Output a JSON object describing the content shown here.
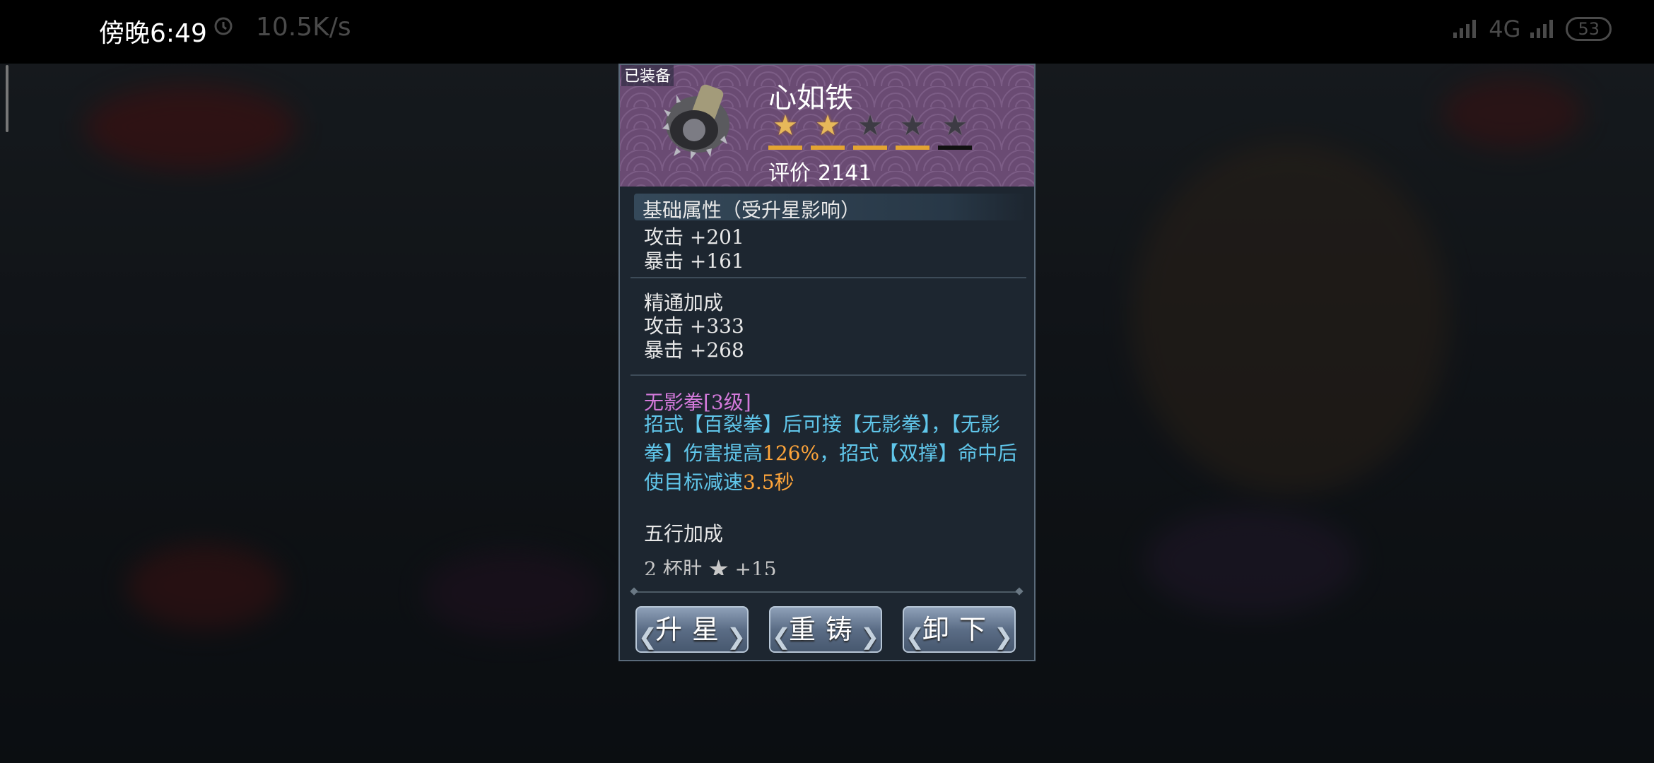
{
  "status_bar": {
    "time": "傍晚6:49",
    "net_speed": "10.5K/s",
    "network": "4G",
    "battery": "53"
  },
  "item": {
    "equipped_tag": "已装备",
    "name": "心如铁",
    "stars_total": 5,
    "stars_filled": 2,
    "rating_label": "评价",
    "rating_value": "2141"
  },
  "base_attrs": {
    "title": "基础属性（受升星影响）",
    "lines": [
      "攻击 +201",
      "暴击 +161"
    ]
  },
  "mastery": {
    "title": "精通加成",
    "lines": [
      "攻击 +333",
      "暴击 +268"
    ]
  },
  "skill": {
    "title": "无影拳[3级]",
    "desc_part1": "招式【百裂拳】后可接【无影拳】，【无影拳】伤害提高",
    "desc_hl1": "126%",
    "desc_part2": "，招式【双撑】命中后使目标减速",
    "desc_hl2": "3.5秒"
  },
  "wuxing": {
    "title": "五行加成",
    "partial_line": "2  杯肚 ★ +15"
  },
  "buttons": {
    "upgrade": "升星",
    "reforge": "重铸",
    "unequip": "卸下"
  },
  "colors": {
    "header_bg": "#6a4b73",
    "star_on": "#e7b85a",
    "skill_title": "#d47adb",
    "skill_desc": "#60c6ea",
    "highlight": "#ffa53a"
  }
}
